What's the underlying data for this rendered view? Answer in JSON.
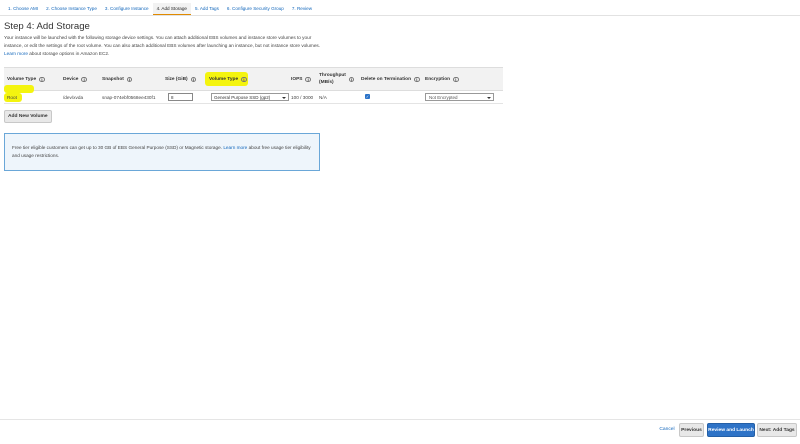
{
  "wizard": {
    "steps": [
      "1. Choose AMI",
      "2. Choose Instance Type",
      "3. Configure Instance",
      "4. Add Storage",
      "5. Add Tags",
      "6. Configure Security Group",
      "7. Review"
    ],
    "active_step": "4. Add Storage"
  },
  "page": {
    "title": "Step 4: Add Storage",
    "intro_text": "Your instance will be launched with the following storage device settings. You can attach additional EBS volumes and instance store volumes to your instance, or edit the settings of the root volume. You can also attach additional EBS volumes after launching an instance, but not instance store volumes.",
    "intro_link": "Learn more",
    "intro_suffix": "about storage options in Amazon EC2."
  },
  "table": {
    "headers": {
      "volume_type": "Volume Type",
      "device": "Device",
      "snapshot": "Snapshot",
      "size": "Size (GiB)",
      "volume_type_2": "Volume Type",
      "iops": "IOPS",
      "throughput_line1": "Throughput",
      "throughput_line2": "(MB/s)",
      "delete_on_termination": "Delete on Termination",
      "encryption": "Encryption"
    },
    "rows": [
      {
        "volume_type": "Root",
        "device": "/dev/xvda",
        "snapshot": "snap-074ebf0568ee430f1",
        "size": "8",
        "ebs_volume_type": "General Purpose SSD (gp2)",
        "iops": "100 / 3000",
        "throughput": "N/A",
        "delete_on_termination": true,
        "encryption": "Not Encrypted"
      }
    ]
  },
  "add_volume_label": "Add New Volume",
  "notice": {
    "text": "Free tier eligible customers can get up to 30 GB of EBS General Purpose (SSD) or Magnetic storage.",
    "link": "Learn more",
    "suffix": "about free usage tier eligibility and usage restrictions."
  },
  "footer": {
    "cancel": "Cancel",
    "previous": "Previous",
    "review_launch": "Review and Launch",
    "next": "Next: Add Tags"
  },
  "colors": {
    "primary": "#2e73c7",
    "link": "#1166bb",
    "highlight": "#f4f40f",
    "notice_border": "#6aa7d8"
  },
  "icons": {
    "info": "info-icon",
    "dropdown": "caret-down-icon",
    "checkbox": "check-icon"
  }
}
